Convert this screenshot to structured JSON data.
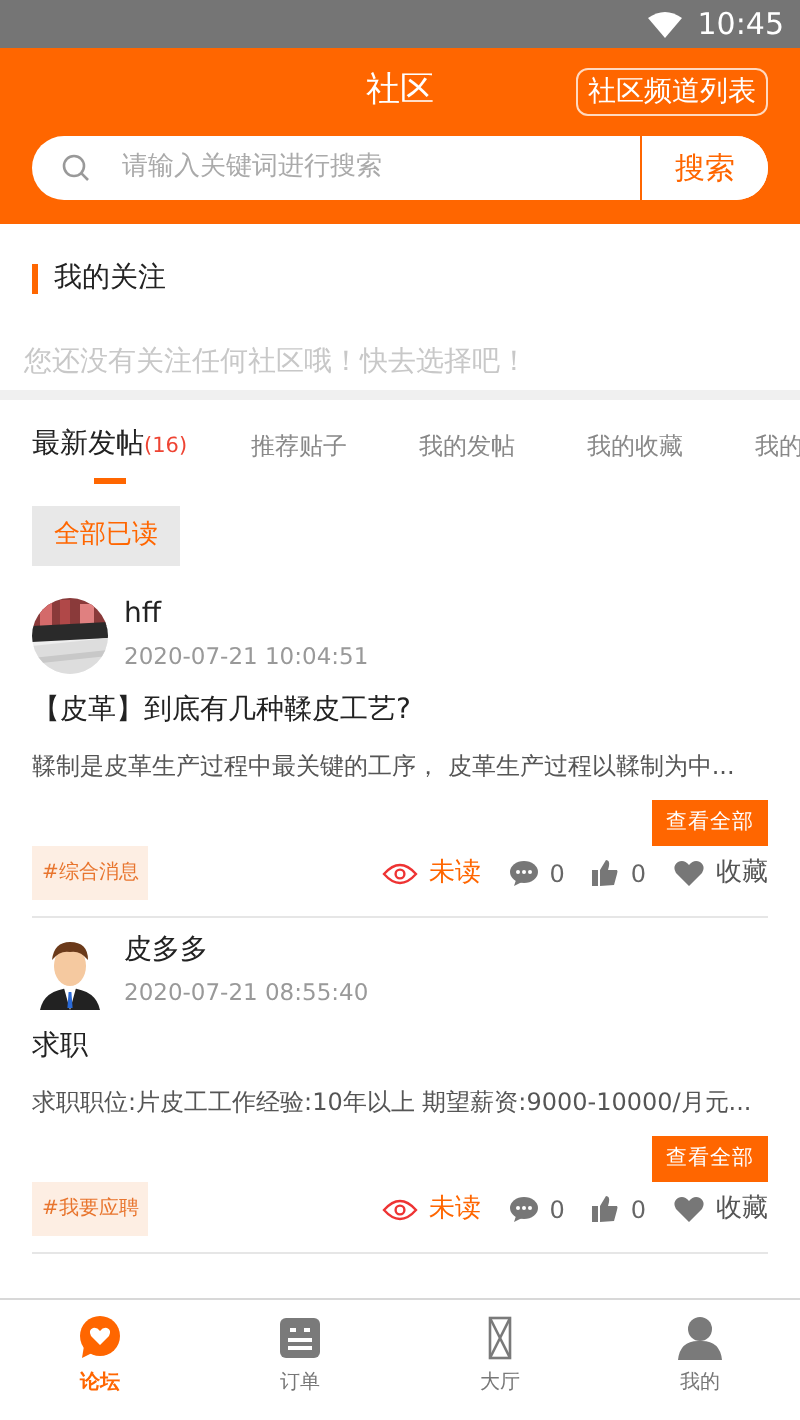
{
  "status_bar": {
    "time": "10:45"
  },
  "header": {
    "title": "社区",
    "channel_list_button": "社区频道列表",
    "search": {
      "placeholder": "请输入关键词进行搜索",
      "button": "搜索"
    }
  },
  "following": {
    "title": "我的关注",
    "empty_text": "您还没有关注任何社区哦！快去选择吧！"
  },
  "tabs": [
    {
      "label": "最新发帖",
      "count": "(16)",
      "selected": true
    },
    {
      "label": "推荐贴子",
      "selected": false
    },
    {
      "label": "我的发帖",
      "selected": false
    },
    {
      "label": "我的收藏",
      "selected": false
    },
    {
      "label": "我的",
      "selected": false
    }
  ],
  "mark_all_read": "全部已读",
  "posts": [
    {
      "author": "hff",
      "time": "2020-07-21 10:04:51",
      "title": "【皮革】到底有几种鞣皮工艺?",
      "excerpt": "鞣制是皮革生产过程中最关键的工序， 皮革生产过程以鞣制为中...",
      "view_all": "查看全部",
      "tag": "#综合消息",
      "read_status": "未读",
      "comments": "0",
      "likes": "0",
      "favorite": "收藏"
    },
    {
      "author": "皮多多",
      "avatar": {
        "kind": "person"
      },
      "time": "2020-07-21 08:55:40",
      "title": "求职",
      "excerpt": "求职职位:片皮工工作经验:10年以上 期望薪资:9000-10000/月元...",
      "view_all": "查看全部",
      "tag": "#我要应聘",
      "read_status": "未读",
      "comments": "0",
      "likes": "0",
      "favorite": "收藏"
    }
  ],
  "bottom_nav": [
    {
      "label": "论坛",
      "selected": true
    },
    {
      "label": "订单",
      "selected": false
    },
    {
      "label": "大厅",
      "selected": false
    },
    {
      "label": "我的",
      "selected": false
    }
  ]
}
